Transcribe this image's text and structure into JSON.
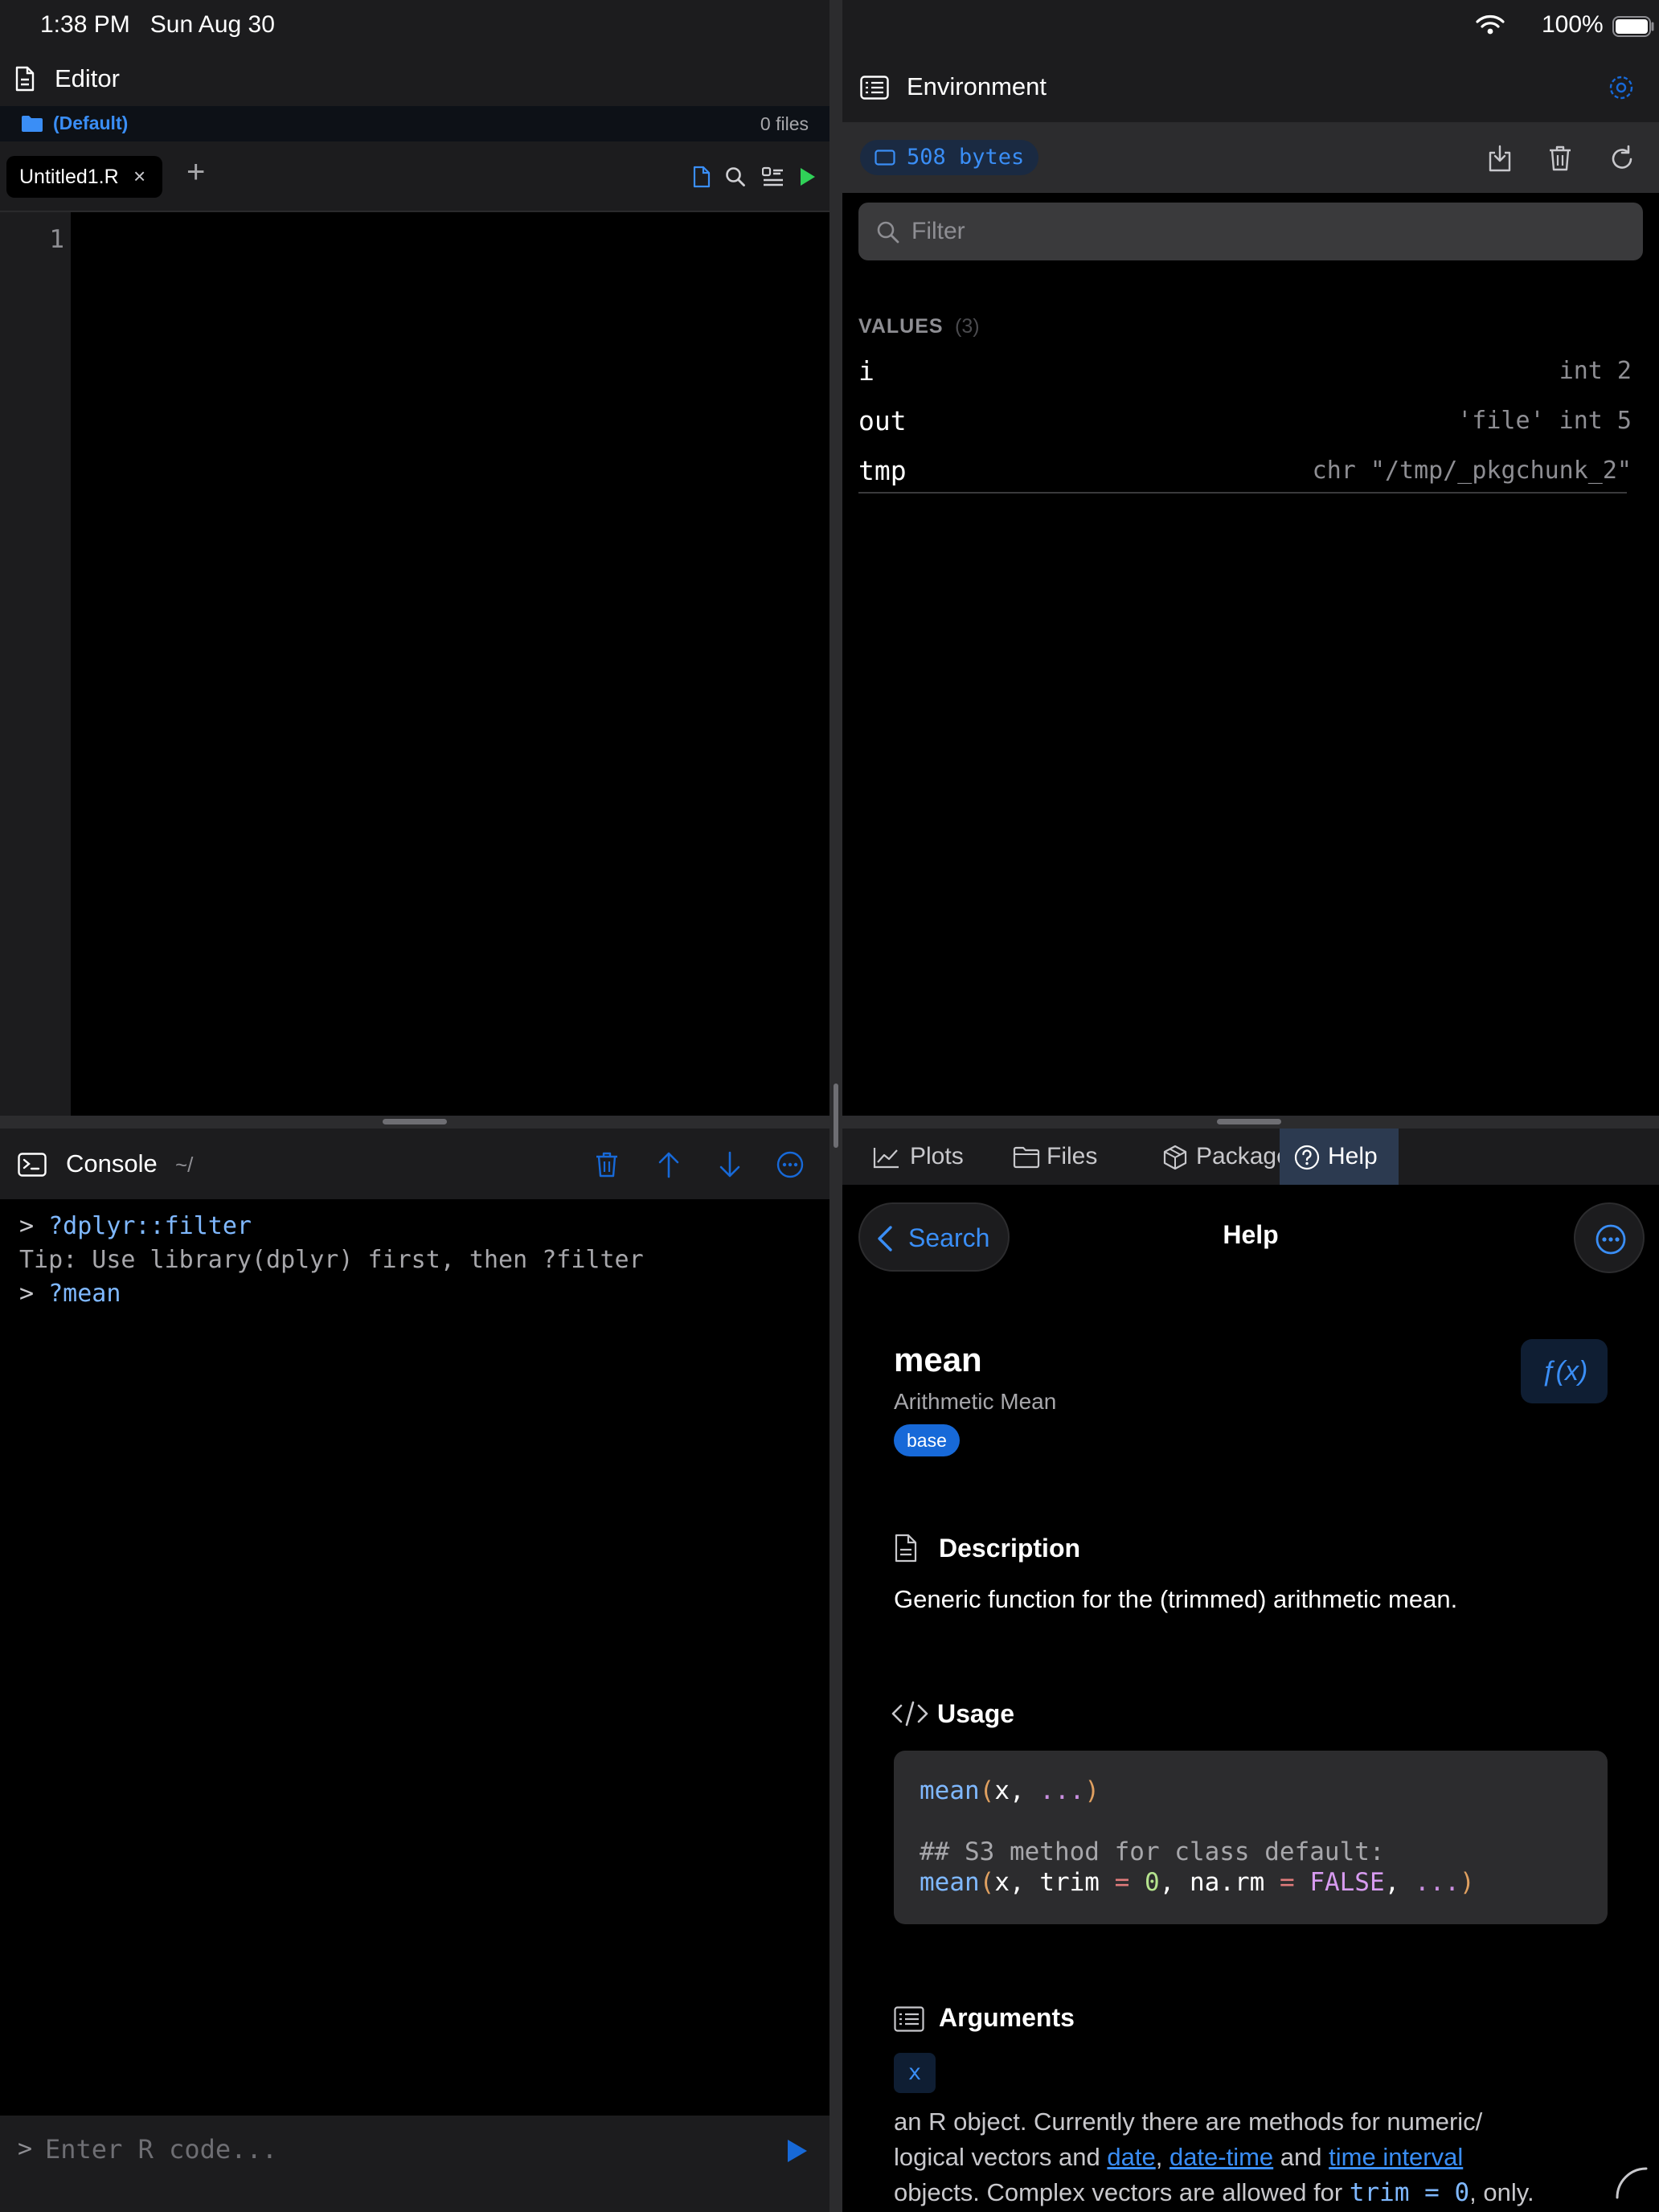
{
  "status_bar": {
    "time": "1:38 PM",
    "date": "Sun Aug 30",
    "battery": "100%"
  },
  "editor": {
    "title": "Editor",
    "project": {
      "name": "(Default)",
      "files": "0 files"
    },
    "tabs": [
      {
        "label": "Untitled1.R",
        "close": "×"
      }
    ],
    "add_tab": "+",
    "line_numbers": [
      "1"
    ]
  },
  "console": {
    "title": "Console",
    "path": "~/",
    "lines": [
      {
        "prompt": ">",
        "text": "?dplyr::filter"
      },
      {
        "text": "Tip: Use library(dplyr) first, then ?filter"
      },
      {
        "prompt": ">",
        "text": "?mean"
      }
    ],
    "input": {
      "prompt": ">",
      "placeholder": "Enter R code..."
    }
  },
  "environment": {
    "title": "Environment",
    "memory": "508 bytes",
    "filter_placeholder": "Filter",
    "values_heading": "VALUES",
    "values_count": "(3)",
    "values": [
      {
        "name": "i",
        "value": "int 2"
      },
      {
        "name": "out",
        "value": "'file' int 5"
      },
      {
        "name": "tmp",
        "value": "chr \"/tmp/_pkgchunk_2\""
      }
    ]
  },
  "tool_tabs": [
    {
      "label": "Plots",
      "icon": "chart-icon"
    },
    {
      "label": "Files",
      "icon": "folder-icon"
    },
    {
      "label": "Packages",
      "icon": "cube-icon"
    },
    {
      "label": "Help",
      "icon": "question-icon",
      "active": true
    }
  ],
  "help": {
    "back_label": "Search",
    "bar_title": "Help",
    "function_name": "mean",
    "function_title": "Arithmetic Mean",
    "package": "base",
    "fx_label": "ƒ(x)",
    "description_heading": "Description",
    "description": "Generic function for the (trimmed) arithmetic mean.",
    "usage_heading": "Usage",
    "usage_line1_fn": "mean",
    "usage_line1_args": "x, ...",
    "usage_comment": "## S3 method for class default:",
    "usage_line2_fn": "mean",
    "arguments_heading": "Arguments",
    "arg_name": "x",
    "arg_text_1": "an R object. Currently there are methods for numeric/",
    "arg_text_2a": "logical vectors and ",
    "arg_link_date": "date",
    "arg_comma": ", ",
    "arg_link_datetime": "date-time",
    "arg_and": " and ",
    "arg_link_interval": "time interval",
    "arg_text_3a": "objects. Complex vectors are allowed for ",
    "arg_code": "trim = 0",
    "arg_text_3b": ", only."
  },
  "colors": {
    "accent": "#3a8ef6",
    "run_green": "#30d158",
    "panel": "#1c1c1e"
  }
}
